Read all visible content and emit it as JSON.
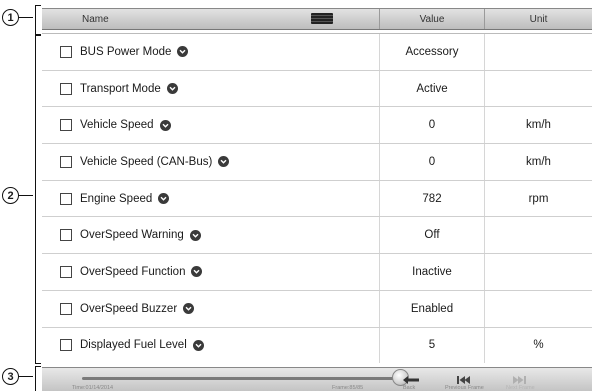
{
  "callouts": [
    "1",
    "2",
    "3"
  ],
  "header": {
    "name": "Name",
    "value": "Value",
    "unit": "Unit"
  },
  "rows": [
    {
      "name": "BUS Power Mode",
      "value": "Accessory",
      "unit": ""
    },
    {
      "name": "Transport Mode",
      "value": "Active",
      "unit": ""
    },
    {
      "name": "Vehicle Speed",
      "value": "0",
      "unit": "km/h"
    },
    {
      "name": "Vehicle Speed (CAN-Bus)",
      "value": "0",
      "unit": "km/h"
    },
    {
      "name": "Engine Speed",
      "value": "782",
      "unit": "rpm"
    },
    {
      "name": "OverSpeed Warning",
      "value": "Off",
      "unit": ""
    },
    {
      "name": "OverSpeed Function",
      "value": "Inactive",
      "unit": ""
    },
    {
      "name": "OverSpeed Buzzer",
      "value": "Enabled",
      "unit": ""
    },
    {
      "name": "Displayed Fuel Level",
      "value": "5",
      "unit": "%"
    }
  ],
  "toolbar": {
    "time_label": "Time:01/14/2014",
    "frame_label": "Frame:85/85",
    "back_label": "Back",
    "previous_frame_label": "Previous Frame",
    "next_frame_label": "Next Frame",
    "slider_position": 1.0
  },
  "icons": {
    "header_handle": "drag-handle-icon",
    "row_info": "chevron-down-circle-icon",
    "back": "back-arrow-icon",
    "previous_frame": "previous-frame-icon",
    "next_frame": "next-frame-icon"
  }
}
